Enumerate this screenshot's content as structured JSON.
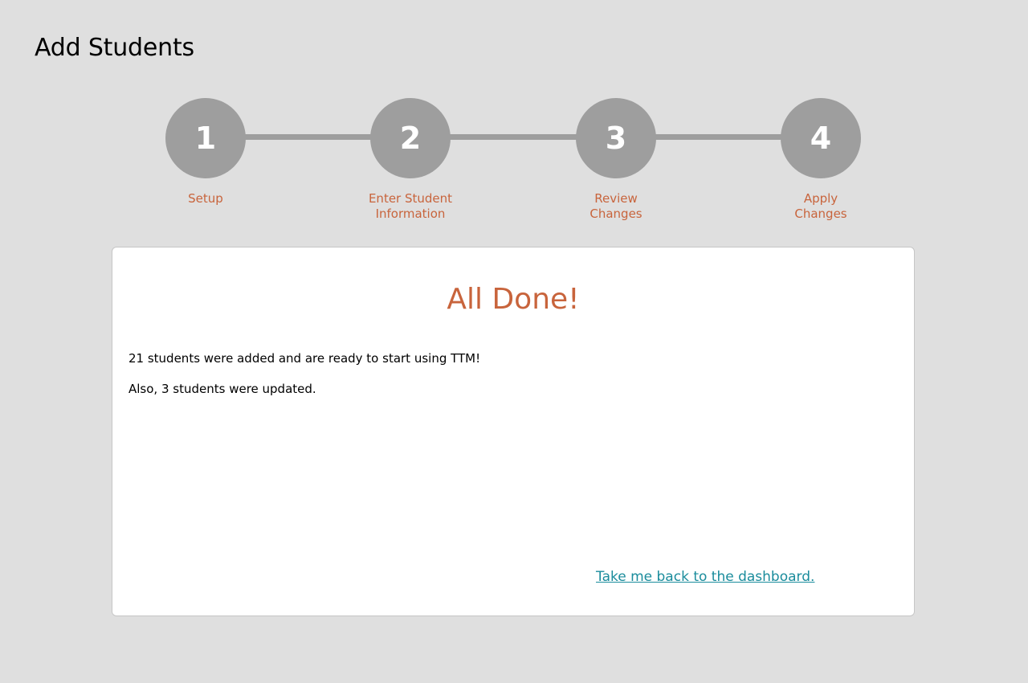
{
  "page": {
    "title": "Add Students"
  },
  "stepper": {
    "steps": [
      {
        "number": "1",
        "label": "Setup"
      },
      {
        "number": "2",
        "label": "Enter Student\nInformation"
      },
      {
        "number": "3",
        "label": "Review\nChanges"
      },
      {
        "number": "4",
        "label": "Apply\nChanges"
      }
    ]
  },
  "result": {
    "heading": "All Done!",
    "added_message": "21 students were added and are ready to start using TTM!",
    "updated_message": "Also, 3 students were updated.",
    "dashboard_link": "Take me back to the dashboard."
  },
  "colors": {
    "background": "#dfdfdf",
    "step_circle": "#9e9e9e",
    "accent": "#c8643c",
    "link": "#1a8c9c"
  }
}
